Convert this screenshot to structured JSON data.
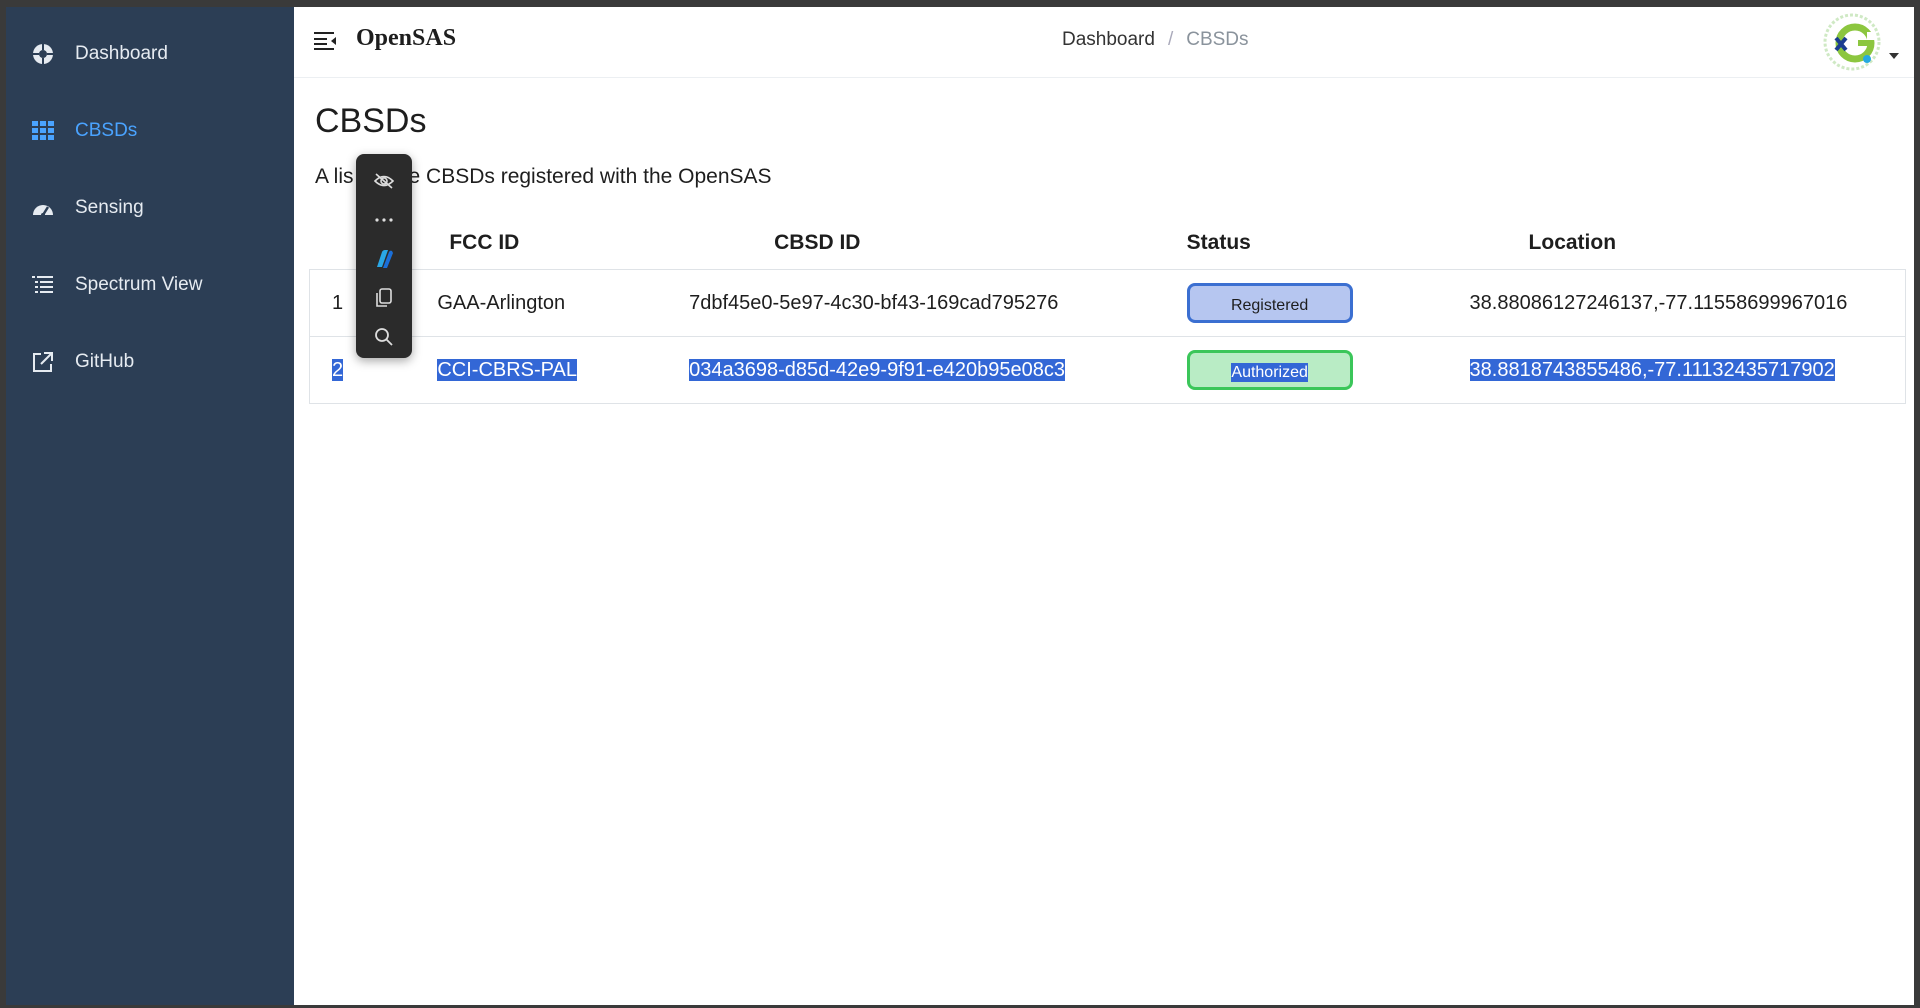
{
  "sidebar": {
    "items": [
      {
        "label": "Dashboard",
        "icon": "dashboard-icon",
        "active": false
      },
      {
        "label": "CBSDs",
        "icon": "grid-icon",
        "active": true
      },
      {
        "label": "Sensing",
        "icon": "speedometer-icon",
        "active": false
      },
      {
        "label": "Spectrum View",
        "icon": "list-icon",
        "active": false
      },
      {
        "label": "GitHub",
        "icon": "external-link-icon",
        "active": false
      }
    ]
  },
  "header": {
    "brand": "OpenSAS",
    "breadcrumb": [
      "Dashboard",
      "CBSDs"
    ],
    "breadcrumb_separator": "/"
  },
  "main": {
    "title": "CBSDs",
    "subtitle_visible_start": "A lis",
    "subtitle_visible_end": "e CBSDs registered with the OpenSAS",
    "table": {
      "columns": [
        "#",
        "FCC ID",
        "CBSD ID",
        "Status",
        "Location"
      ],
      "rows": [
        {
          "num": "1",
          "fcc_id": "GAA-Arlington",
          "cbsd_id": "7dbf45e0-5e97-4c30-bf43-169cad795276",
          "status": "Registered",
          "location": "38.88086127246137,-77.11558699967016"
        },
        {
          "num": "2",
          "fcc_id": "CCI-CBRS-PAL",
          "cbsd_id": "034a3698-d85d-42e9-9f91-e420b95e08c3",
          "status": "Authorized",
          "location": "38.8818743855486,-77.11132435717902"
        }
      ]
    }
  },
  "floating_toolbar": {
    "buttons": [
      "eye-off-icon",
      "more-icon",
      "copilot-icon",
      "copy-icon",
      "search-icon"
    ]
  },
  "colors": {
    "sidebar_bg": "#2c3e55",
    "active": "#4aa3ff",
    "selection": "#3367d6",
    "registered_border": "#3b6fd1",
    "authorized_border": "#3bc65a"
  }
}
